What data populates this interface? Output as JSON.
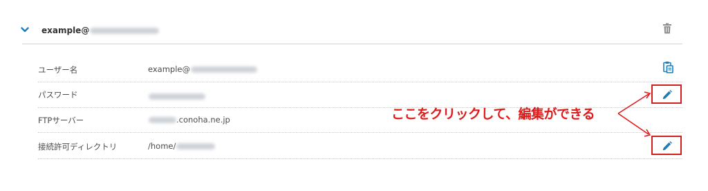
{
  "account": {
    "email_prefix": "example@",
    "expanded": true,
    "icons": {
      "expand": "chevron-down-icon",
      "delete": "trash-icon"
    }
  },
  "details": {
    "username": {
      "label": "ユーザー名",
      "value_prefix": "example@",
      "icon": "clipboard-copy-icon"
    },
    "password": {
      "label": "パスワード",
      "icon": "pencil-icon"
    },
    "ftp_server": {
      "label": "FTPサーバー",
      "value_suffix": ".conoha.ne.jp"
    },
    "allowed_dir": {
      "label": "接続許可ディレクトリ",
      "value_prefix": "/home/",
      "icon": "pencil-icon"
    }
  },
  "annotation": {
    "text": "ここをクリックして、編集ができる",
    "color": "#e01919"
  },
  "colors": {
    "accent": "#1a7fb8",
    "highlight_border": "#d21d1d",
    "divider": "#cfd3d7"
  }
}
